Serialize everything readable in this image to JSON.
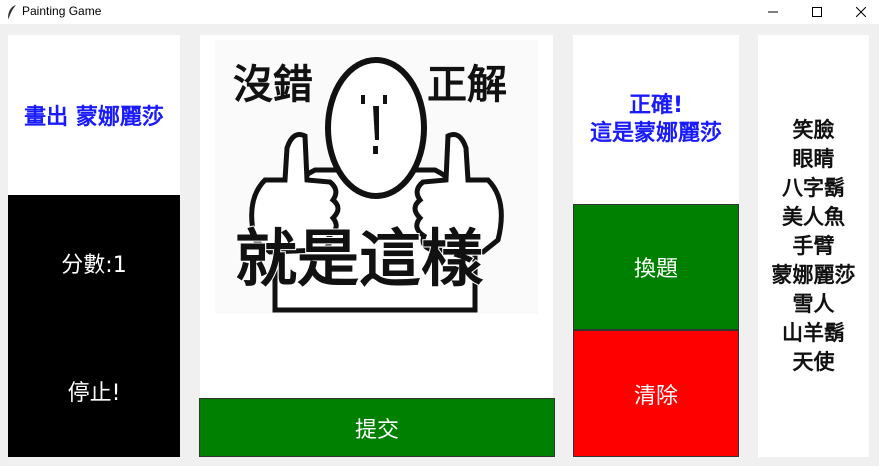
{
  "window": {
    "title": "Painting Game"
  },
  "prompt": {
    "text": "畫出 蒙娜麗莎"
  },
  "score": {
    "text": "分數:1"
  },
  "stop_button": {
    "label": "停止!"
  },
  "canvas": {
    "image_caption_top_left": "沒錯",
    "image_caption_top_right": "正解",
    "image_caption_bottom": "就是這樣"
  },
  "submit_button": {
    "label": "提交"
  },
  "result": {
    "line1": "正確!",
    "line2": "這是蒙娜麗莎"
  },
  "change_button": {
    "label": "換題"
  },
  "clear_button": {
    "label": "清除"
  },
  "word_list": [
    "笑臉",
    "眼睛",
    "八字鬍",
    "美人魚",
    "手臂",
    "蒙娜麗莎",
    "雪人",
    "山羊鬍",
    "天使"
  ],
  "colors": {
    "prompt_blue": "#1a1aff",
    "green": "#008000",
    "red": "#ff0000",
    "black": "#000000"
  },
  "icons": {
    "app": "feather-icon",
    "minimize": "minimize-icon",
    "maximize": "maximize-icon",
    "close": "close-icon"
  }
}
